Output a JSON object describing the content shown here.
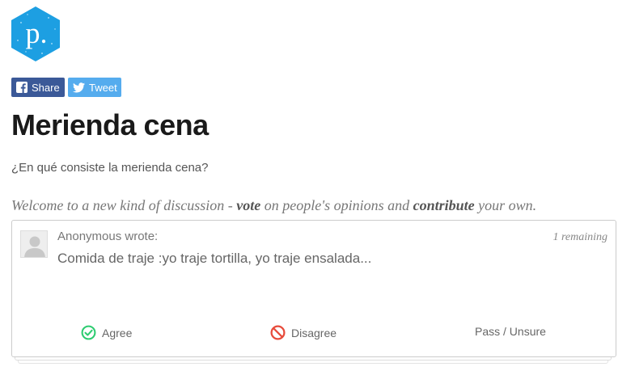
{
  "logo": {
    "letter": "p."
  },
  "share": {
    "facebook_label": "Share",
    "twitter_label": "Tweet"
  },
  "conversation": {
    "title": "Merienda cena",
    "description": "¿En qué consiste la merienda cena?"
  },
  "welcome": {
    "part1": "Welcome to a new kind of discussion - ",
    "vote": "vote",
    "part2": " on people's opinions and ",
    "contribute": "contribute",
    "part3": " your own."
  },
  "card": {
    "author": "Anonymous wrote:",
    "remaining": "1 remaining",
    "comment": "Comida de traje :yo traje tortilla, yo traje ensalada...",
    "agree_label": "Agree",
    "disagree_label": "Disagree",
    "pass_label": "Pass / Unsure"
  },
  "colors": {
    "logo": "#1d9fe2",
    "facebook": "#3b5998",
    "twitter": "#55acee",
    "agree": "#2ecc71",
    "disagree": "#e74c3c"
  }
}
